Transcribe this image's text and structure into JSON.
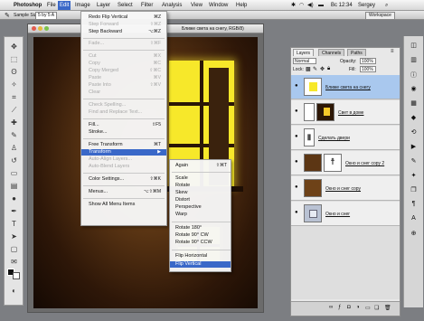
{
  "menubar": {
    "apple": "",
    "items": [
      "Photoshop",
      "File",
      "Edit",
      "Image",
      "Layer",
      "Select",
      "Filter",
      "Analysis",
      "View",
      "Window",
      "Help"
    ],
    "clock": "Вс 12:34",
    "user": "Sergey"
  },
  "options_bar": {
    "sample_size_label": "Sample Size:",
    "sample_size_value": "5 by 5 A",
    "workspace": "Workspace"
  },
  "document": {
    "title": "Ближе света на снегу, RGB/8)"
  },
  "edit_menu": {
    "items": [
      {
        "label": "Redo Flip Vertical",
        "shortcut": "⌘Z",
        "enabled": true
      },
      {
        "label": "Step Forward",
        "shortcut": "⇧⌘Z",
        "enabled": false
      },
      {
        "label": "Step Backward",
        "shortcut": "⌥⌘Z",
        "enabled": true
      },
      {
        "label": "Fade...",
        "shortcut": "⇧⌘F",
        "enabled": false
      },
      {
        "label": "Cut",
        "shortcut": "⌘X",
        "enabled": false
      },
      {
        "label": "Copy",
        "shortcut": "⌘C",
        "enabled": false
      },
      {
        "label": "Copy Merged",
        "shortcut": "⇧⌘C",
        "enabled": false
      },
      {
        "label": "Paste",
        "shortcut": "⌘V",
        "enabled": false
      },
      {
        "label": "Paste Into",
        "shortcut": "⇧⌘V",
        "enabled": false
      },
      {
        "label": "Clear",
        "shortcut": "",
        "enabled": false
      },
      {
        "label": "Check Spelling...",
        "shortcut": "",
        "enabled": false
      },
      {
        "label": "Find and Replace Text...",
        "shortcut": "",
        "enabled": false
      },
      {
        "label": "Fill...",
        "shortcut": "⇧F5",
        "enabled": true
      },
      {
        "label": "Stroke...",
        "shortcut": "",
        "enabled": true
      },
      {
        "label": "Free Transform",
        "shortcut": "⌘T",
        "enabled": true
      },
      {
        "label": "Transform",
        "shortcut": "▶",
        "enabled": true,
        "highlighted": true
      },
      {
        "label": "Auto-Align Layers...",
        "shortcut": "",
        "enabled": false
      },
      {
        "label": "Auto-Blend Layers",
        "shortcut": "",
        "enabled": false
      },
      {
        "label": "Color Settings...",
        "shortcut": "⇧⌘K",
        "enabled": true
      },
      {
        "label": "Menus...",
        "shortcut": "⌥⇧⌘M",
        "enabled": true
      },
      {
        "label": "Show All Menu Items",
        "shortcut": "",
        "enabled": true
      }
    ]
  },
  "transform_submenu": {
    "items": [
      {
        "label": "Again",
        "shortcut": "⇧⌘T"
      },
      {
        "label": "Scale",
        "shortcut": ""
      },
      {
        "label": "Rotate",
        "shortcut": ""
      },
      {
        "label": "Skew",
        "shortcut": ""
      },
      {
        "label": "Distort",
        "shortcut": ""
      },
      {
        "label": "Perspective",
        "shortcut": ""
      },
      {
        "label": "Warp",
        "shortcut": ""
      },
      {
        "label": "Rotate 180°",
        "shortcut": ""
      },
      {
        "label": "Rotate 90° CW",
        "shortcut": ""
      },
      {
        "label": "Rotate 90° CCW",
        "shortcut": ""
      },
      {
        "label": "Flip Horizontal",
        "shortcut": ""
      },
      {
        "label": "Flip Vertical",
        "shortcut": "",
        "highlighted": true
      }
    ]
  },
  "layers_panel": {
    "tabs": [
      "Layers",
      "Channels",
      "Paths"
    ],
    "blend_mode": "Normal",
    "opacity_label": "Opacity:",
    "opacity_value": "100%",
    "lock_label": "Lock:",
    "fill_label": "Fill:",
    "fill_value": "100%",
    "layers": [
      {
        "name": "Ближе света на снегу",
        "selected": true
      },
      {
        "name": "Свет в доме",
        "selected": false
      },
      {
        "name": "Сделать двери",
        "selected": false
      },
      {
        "name": "Окно и снег copy 2",
        "selected": false
      },
      {
        "name": "Окно и снег copy",
        "selected": false
      },
      {
        "name": "Окно и снег",
        "selected": false
      }
    ]
  },
  "colors": {
    "menu_highlight": "#3a68c8",
    "window_glow": "#f7e82a",
    "selected_layer": "#a9c8ee"
  }
}
